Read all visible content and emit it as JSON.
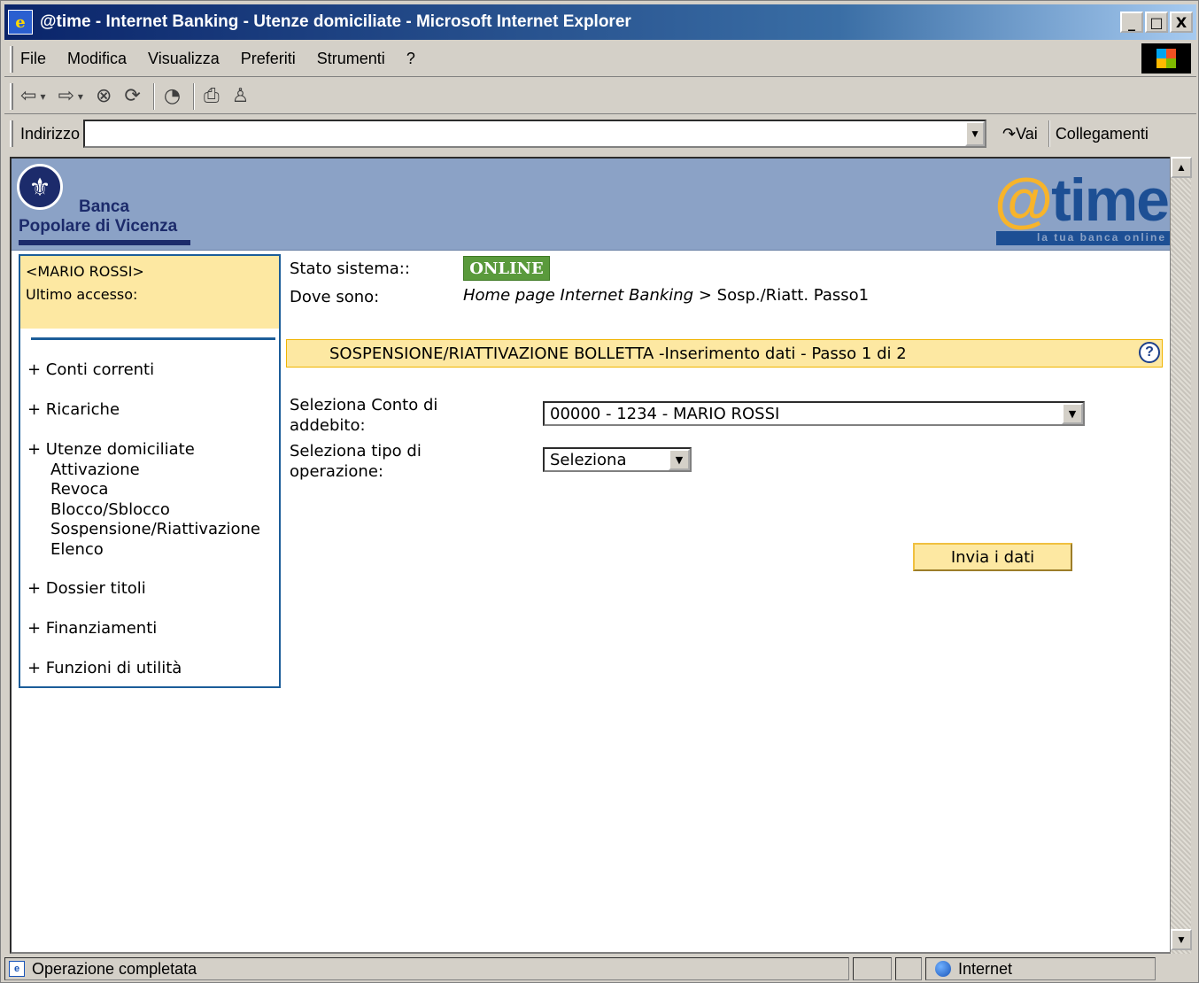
{
  "window": {
    "title": "@time - Internet Banking - Utenze domiciliate - Microsoft Internet Explorer",
    "app_icon": "ie-icon",
    "controls": {
      "minimize": "_",
      "maximize": "□",
      "close": "X"
    }
  },
  "menubar": {
    "items": [
      "File",
      "Modifica",
      "Visualizza",
      "Preferiti",
      "Strumenti",
      "?"
    ]
  },
  "toolbar": {
    "icons": [
      "back-icon",
      "forward-icon",
      "stop-icon",
      "refresh-icon",
      "history-icon",
      "print-icon",
      "messenger-icon"
    ]
  },
  "addressbar": {
    "label": "Indirizzo",
    "value": "",
    "go_label": "Vai",
    "links_label": "Collegamenti"
  },
  "header": {
    "bank_line1": "Banca",
    "bank_line2": "Popolare di Vicenza",
    "brand_at": "@",
    "brand_time": "time",
    "tagline": "la tua banca online"
  },
  "sidebar": {
    "user_name": "<MARIO ROSSI>",
    "last_access": "Ultimo accesso:",
    "nav": [
      {
        "label": "+ Conti correnti"
      },
      {
        "label": "+ Ricariche"
      },
      {
        "label": "+ Utenze domiciliate"
      },
      {
        "label": "+ Dossier titoli"
      },
      {
        "label": "+ Finanziamenti"
      },
      {
        "label": "+ Funzioni di utilità"
      }
    ],
    "sub_nav": [
      "Attivazione",
      "Revoca",
      "Blocco/Sblocco",
      "Sospensione/Riattivazione",
      "Elenco"
    ]
  },
  "main": {
    "status_label": "Stato sistema::",
    "status_value": "ONLINE",
    "location_label": "Dove sono:",
    "breadcrumb_home": "Home page Internet Banking",
    "breadcrumb_sep": " > ",
    "breadcrumb_current": "Sosp./Riatt. Passo1",
    "step_title": "SOSPENSIONE/RIATTIVAZIONE BOLLETTA -Inserimento dati - Passo 1 di 2",
    "help": "?",
    "account_label_1": "Seleziona Conto di",
    "account_label_2": "addebito:",
    "account_value": "00000 - 1234 - MARIO ROSSI",
    "operation_label_1": "Seleziona tipo di",
    "operation_label_2": "operazione:",
    "operation_value": "Seleziona",
    "submit_label": "Invia i dati"
  },
  "statusbar": {
    "message": "Operazione completata",
    "zone": "Internet"
  },
  "colors": {
    "header_bg": "#8ba2c6",
    "panel_yellow": "#fde8a2",
    "nav_border": "#1c5d99",
    "online_green": "#5a9a3c",
    "brand_orange": "#f7b42b",
    "brand_blue": "#1d4f94"
  }
}
